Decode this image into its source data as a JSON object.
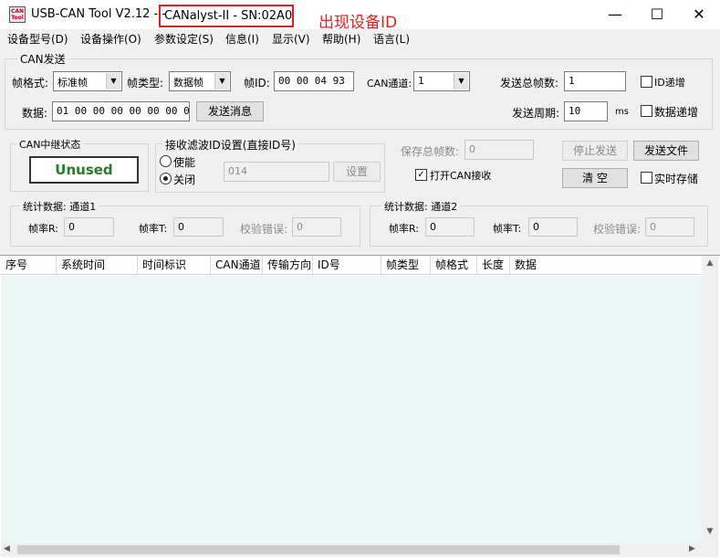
{
  "window": {
    "icon_text": "CAN Tool",
    "title": "USB-CAN Tool V2.12 -  -",
    "device": "CANalyst-II - SN:02A0",
    "annotation": "出现设备ID",
    "controls": {
      "minimize": "—",
      "maximize": "☐",
      "close": "✕"
    }
  },
  "menu": [
    "设备型号(D)",
    "设备操作(O)",
    "参数设定(S)",
    "信息(I)",
    "显示(V)",
    "帮助(H)",
    "语言(L)"
  ],
  "can_send": {
    "group_title": "CAN发送",
    "frame_format_label": "帧格式:",
    "frame_format_value": "标准帧",
    "frame_type_label": "帧类型:",
    "frame_type_value": "数据帧",
    "frame_id_label": "帧ID:",
    "frame_id_value": "00 00 04 93",
    "channel_label": "CAN通道:",
    "channel_value": "1",
    "total_frames_label": "发送总帧数:",
    "total_frames_value": "1",
    "id_increment_label": "ID递增",
    "data_label": "数据:",
    "data_value": "01 00 00 00 00 00 00 00",
    "send_button": "发送消息",
    "period_label": "发送周期:",
    "period_value": "10",
    "period_unit": "ms",
    "data_increment_label": "数据递增"
  },
  "relay": {
    "title": "CAN中继状态",
    "status": "Unused"
  },
  "filter": {
    "title": "接收滤波ID设置(直接ID号)",
    "enable_label": "使能",
    "disable_label": "关闭",
    "id_value": "014",
    "set_button": "设置"
  },
  "receive": {
    "save_total_label": "保存总帧数:",
    "save_total_value": "0",
    "open_receive_label": "打开CAN接收",
    "open_receive_checked": true,
    "stop_button": "停止发送",
    "send_file_button": "发送文件",
    "clear_button": "清 空",
    "realtime_save_label": "实时存储"
  },
  "stats1": {
    "title": "统计数据: 通道1",
    "rate_r_label": "帧率R:",
    "rate_r_value": "0",
    "rate_t_label": "帧率T:",
    "rate_t_value": "0",
    "error_label": "校验错误:",
    "error_value": "0"
  },
  "stats2": {
    "title": "统计数据: 通道2",
    "rate_r_label": "帧率R:",
    "rate_r_value": "0",
    "rate_t_label": "帧率T:",
    "rate_t_value": "0",
    "error_label": "校验错误:",
    "error_value": "0"
  },
  "table": {
    "columns": [
      "序号",
      "系统时间",
      "时间标识",
      "CAN通道",
      "传输方向",
      "ID号",
      "帧类型",
      "帧格式",
      "长度",
      "数据"
    ]
  },
  "colors": {
    "annotation_red": "#e02020",
    "unused_green": "#2a7a2a",
    "table_body": "#e9f8f5"
  }
}
